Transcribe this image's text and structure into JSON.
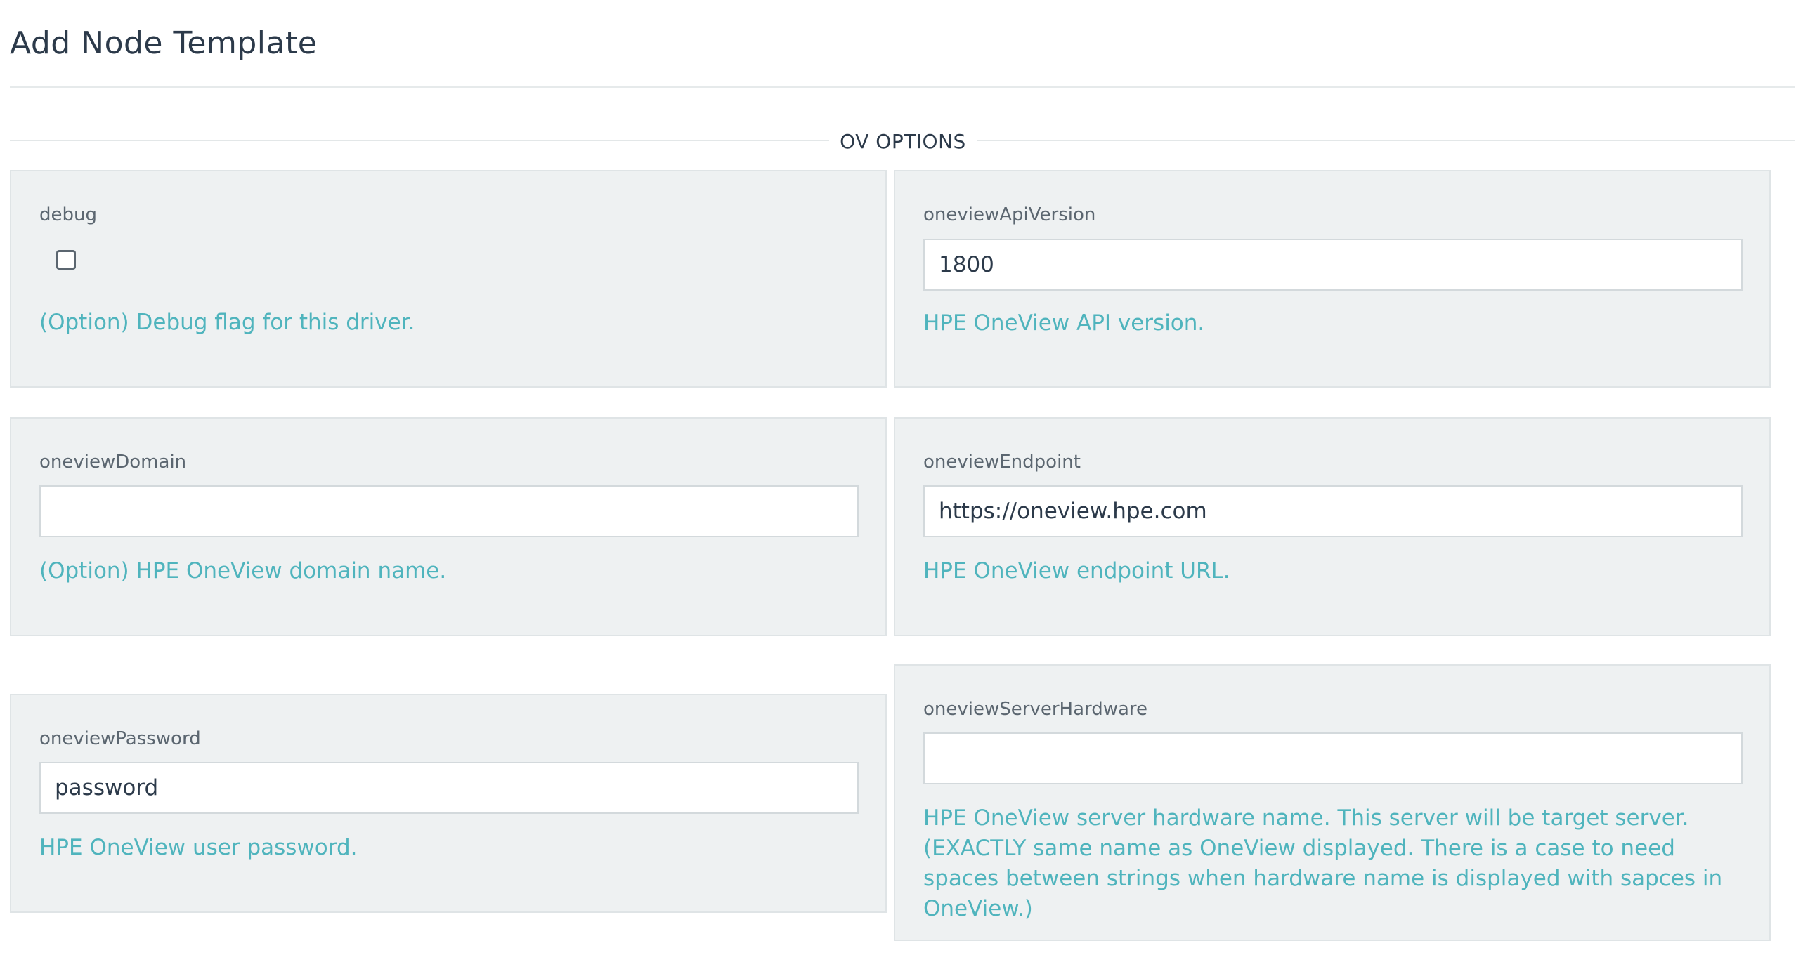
{
  "page": {
    "title": "Add Node Template",
    "section_label": "OV OPTIONS"
  },
  "fields": {
    "debug": {
      "label": "debug",
      "checked": false,
      "help": "(Option) Debug flag for this driver."
    },
    "oneviewApiVersion": {
      "label": "oneviewApiVersion",
      "value": "1800",
      "help": "HPE OneView API version."
    },
    "oneviewDomain": {
      "label": "oneviewDomain",
      "value": "",
      "help": "(Option) HPE OneView domain name."
    },
    "oneviewEndpoint": {
      "label": "oneviewEndpoint",
      "value": "https://oneview.hpe.com",
      "help": "HPE OneView endpoint URL."
    },
    "oneviewPassword": {
      "label": "oneviewPassword",
      "value": "password",
      "help": "HPE OneView user password."
    },
    "oneviewServerHardware": {
      "label": "oneviewServerHardware",
      "value": "",
      "help": "HPE OneView server hardware name. This server will be target server. (EXACTLY same name as OneView displayed. There is a case to need spaces between strings when hardware name is displayed with sapces in OneView.)"
    }
  },
  "colors": {
    "card_background": "#eef1f2",
    "help_text": "#4fb4bd",
    "title_text": "#2c3a4a"
  }
}
